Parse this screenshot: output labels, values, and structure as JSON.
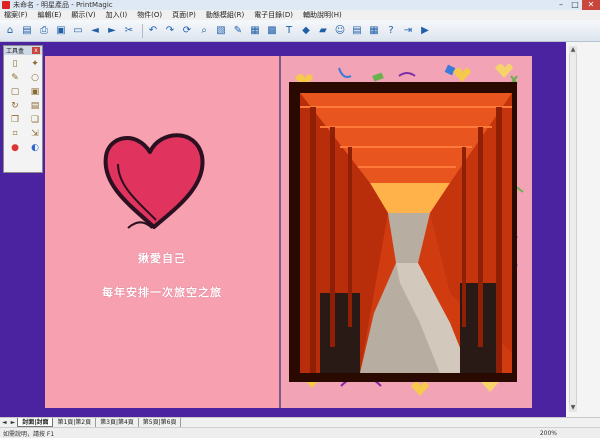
{
  "window": {
    "title": "未命名 - 明星產品 - PrintMagic",
    "minimize": "–",
    "maximize": "□",
    "close": "✕"
  },
  "menu": [
    "檔案(F)",
    "編輯(E)",
    "顯示(V)",
    "加入(I)",
    "物件(O)",
    "頁面(P)",
    "動態模組(R)",
    "電子目錄(D)",
    "輔助說明(H)"
  ],
  "toolbox": {
    "title": "工具盒",
    "close": "x",
    "tools": [
      "new-page-icon",
      "magic-wand-icon",
      "pencil-icon",
      "circle-icon",
      "frame-icon",
      "image-icon",
      "rotate-icon",
      "arrange-icon",
      "copy-icon",
      "duplicate-icon",
      "crop-icon",
      "resize-icon",
      "color-icon",
      "shadow-icon"
    ]
  },
  "canvas": {
    "left_page": {
      "line1": "揪愛自己",
      "line2": "每年安排一次旅空之旅"
    },
    "colors": {
      "workspace": "#4b23a0",
      "left_page": "#f6a0b0",
      "right_page": "#f2a3b5",
      "heart": "#e0335e"
    }
  },
  "tabs": [
    "封面|封面",
    "第1頁|第2頁",
    "第3頁|第4頁",
    "第5頁|第6頁"
  ],
  "tab_nav": [
    "◄",
    "►"
  ],
  "status": {
    "help_text": "如需說明，請按 F1",
    "zoom": "200%"
  }
}
